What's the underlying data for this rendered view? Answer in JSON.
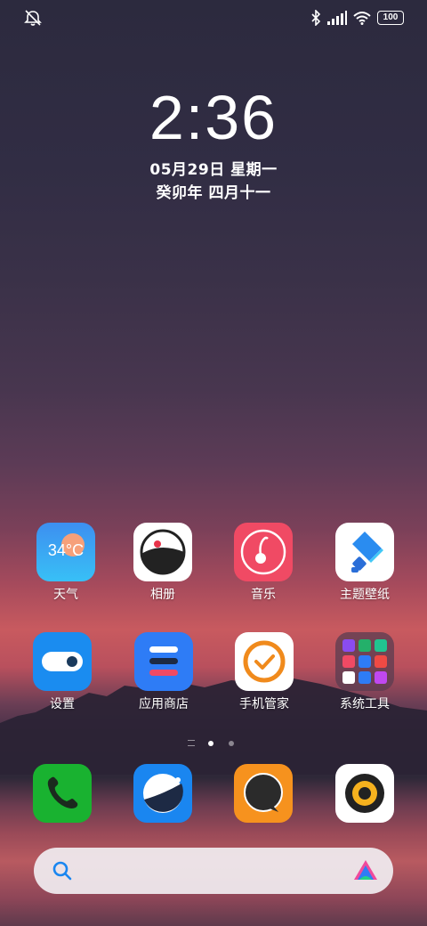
{
  "status_bar": {
    "left_icon": "notifications-muted-icon",
    "icons": [
      "bluetooth-icon",
      "signal-icon",
      "wifi-icon"
    ],
    "battery": "100"
  },
  "clock": {
    "time": "2:36",
    "date": "05月29日 星期一",
    "lunar": "癸卯年 四月十一"
  },
  "apps_row1": [
    {
      "label": "天气",
      "icon": "weather-icon",
      "temp": "34°C"
    },
    {
      "label": "相册",
      "icon": "gallery-icon"
    },
    {
      "label": "音乐",
      "icon": "music-icon"
    },
    {
      "label": "主题壁纸",
      "icon": "themes-icon"
    }
  ],
  "apps_row2": [
    {
      "label": "设置",
      "icon": "settings-icon"
    },
    {
      "label": "应用商店",
      "icon": "app-store-icon"
    },
    {
      "label": "手机管家",
      "icon": "security-icon"
    },
    {
      "label": "系统工具",
      "icon": "system-tools-folder-icon"
    }
  ],
  "page_indicator": {
    "pages": 2,
    "active": 1
  },
  "dock": [
    "phone-icon",
    "browser-icon",
    "messages-icon",
    "camera-icon"
  ],
  "search": {
    "icon": "search-icon",
    "assistant_icon": "assistant-icon"
  },
  "colors": {
    "weather": "#3aa0f0",
    "music": "#f04a64",
    "settings": "#1a8cf0",
    "appstore": "#2e7cf6",
    "security": "#f08a1c",
    "phone": "#19b230",
    "browser": "#1a86f0",
    "messages": "#f6921e"
  }
}
